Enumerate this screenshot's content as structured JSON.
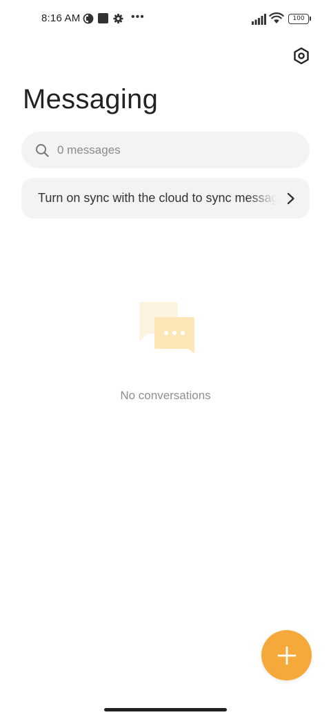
{
  "status_bar": {
    "time": "8:16 AM",
    "battery": "100",
    "icons": [
      "vpn-icon",
      "square-notification-icon",
      "gear-icon",
      "more-dots-icon",
      "signal-icon",
      "wifi-icon",
      "battery-icon"
    ]
  },
  "header": {
    "title": "Messaging",
    "settings_icon": "settings-hexagon-icon"
  },
  "search": {
    "placeholder": "0 messages",
    "icon": "search-icon"
  },
  "sync_banner": {
    "text": "Turn on sync with the cloud to sync messages",
    "icon": "chevron-right-icon"
  },
  "empty_state": {
    "illustration": "chat-bubbles-icon",
    "text": "No conversations"
  },
  "fab": {
    "icon": "plus-icon",
    "color": "#f4a93a"
  },
  "colors": {
    "accent": "#f4a93a",
    "surface": "#f3f3f3",
    "text_primary": "#222222",
    "text_secondary": "#8e8e8e"
  }
}
